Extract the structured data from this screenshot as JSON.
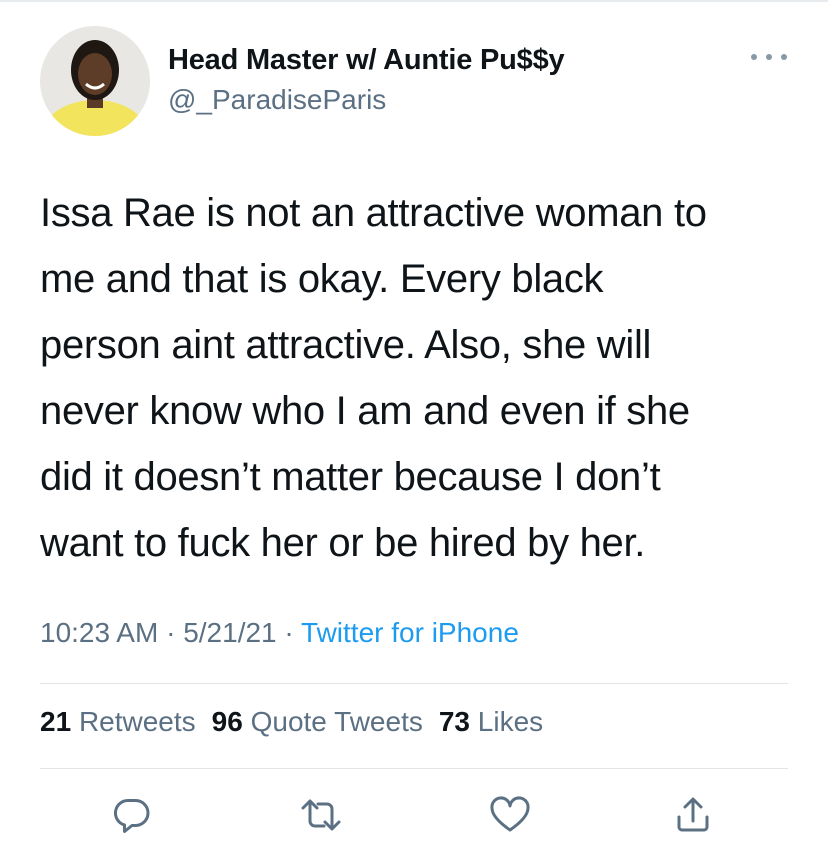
{
  "author": {
    "display_name": "Head Master w/ Auntie Pu$$y",
    "handle": "@_ParadiseParis"
  },
  "tweet": {
    "text_lines": [
      "Issa Rae is not an attractive woman to",
      "me and that is okay. Every black",
      "person aint attractive. Also, she will",
      "never know who I am and even if she",
      "did it doesn’t matter because I don’t",
      "want to fuck her or be hired by her."
    ],
    "time": "10:23 AM",
    "date": "5/21/21",
    "separator": "·",
    "source": "Twitter for iPhone"
  },
  "stats": {
    "retweets_count": "21",
    "retweets_label": "Retweets",
    "quote_tweets_count": "96",
    "quote_tweets_label": "Quote Tweets",
    "likes_count": "73",
    "likes_label": "Likes"
  },
  "icons": {
    "more": "more-icon",
    "reply": "reply-icon",
    "retweet": "retweet-icon",
    "like": "heart-icon",
    "share": "share-icon"
  },
  "colors": {
    "text": "#0f1419",
    "secondary": "#5b7083",
    "link": "#1d9bf0",
    "avatar_shirt": "#f2e45c"
  }
}
